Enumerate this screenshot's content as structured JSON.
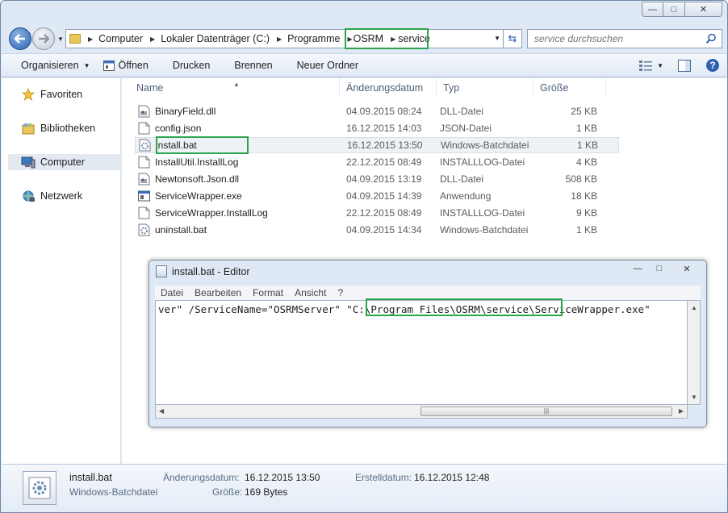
{
  "window": {
    "minimize": "—",
    "maximize": "□",
    "close": "✕"
  },
  "address": {
    "crumbs": [
      "Computer",
      "Lokaler Datenträger (C:)",
      "Programme",
      "OSRM",
      "service"
    ],
    "search_placeholder": "service durchsuchen"
  },
  "toolbar": {
    "organize": "Organisieren",
    "open": "Öffnen",
    "print": "Drucken",
    "burn": "Brennen",
    "new_folder": "Neuer Ordner"
  },
  "nav": {
    "favorites": "Favoriten",
    "libraries": "Bibliotheken",
    "computer": "Computer",
    "network": "Netzwerk"
  },
  "columns": {
    "name": "Name",
    "date": "Änderungsdatum",
    "type": "Typ",
    "size": "Größe"
  },
  "files": [
    {
      "name": "BinaryField.dll",
      "date": "04.09.2015 08:24",
      "type": "DLL-Datei",
      "size": "25 KB",
      "icon": "dll-icon"
    },
    {
      "name": "config.json",
      "date": "16.12.2015 14:03",
      "type": "JSON-Datei",
      "size": "1 KB",
      "icon": "file-icon"
    },
    {
      "name": "install.bat",
      "date": "16.12.2015 13:50",
      "type": "Windows-Batchdatei",
      "size": "1 KB",
      "icon": "batch-icon"
    },
    {
      "name": "InstallUtil.InstallLog",
      "date": "22.12.2015 08:49",
      "type": "INSTALLLOG-Datei",
      "size": "4 KB",
      "icon": "file-icon"
    },
    {
      "name": "Newtonsoft.Json.dll",
      "date": "04.09.2015 13:19",
      "type": "DLL-Datei",
      "size": "508 KB",
      "icon": "dll-icon"
    },
    {
      "name": "ServiceWrapper.exe",
      "date": "04.09.2015 14:39",
      "type": "Anwendung",
      "size": "18 KB",
      "icon": "exe-icon"
    },
    {
      "name": "ServiceWrapper.InstallLog",
      "date": "22.12.2015 08:49",
      "type": "INSTALLLOG-Datei",
      "size": "9 KB",
      "icon": "file-icon"
    },
    {
      "name": "uninstall.bat",
      "date": "04.09.2015 14:34",
      "type": "Windows-Batchdatei",
      "size": "1 KB",
      "icon": "batch-icon"
    }
  ],
  "editor": {
    "title": "install.bat - Editor",
    "menu": [
      "Datei",
      "Bearbeiten",
      "Format",
      "Ansicht",
      "?"
    ],
    "line_prefix": "ver\" /ServiceName=\"OSRMServer\" \"",
    "line_path": "C:\\Program Files\\OSRM\\service\\",
    "line_suffix": "ServiceWrapper.exe\""
  },
  "details": {
    "filename": "install.bat",
    "filetype": "Windows-Batchdatei",
    "modified_label": "Änderungsdatum:",
    "modified_value": "16.12.2015 13:50",
    "created_label": "Erstelldatum:",
    "created_value": "16.12.2015 12:48",
    "size_label": "Größe:",
    "size_value": "169 Bytes"
  },
  "colors": {
    "highlight": "#2aa54b",
    "accent": "#2c62b0"
  }
}
